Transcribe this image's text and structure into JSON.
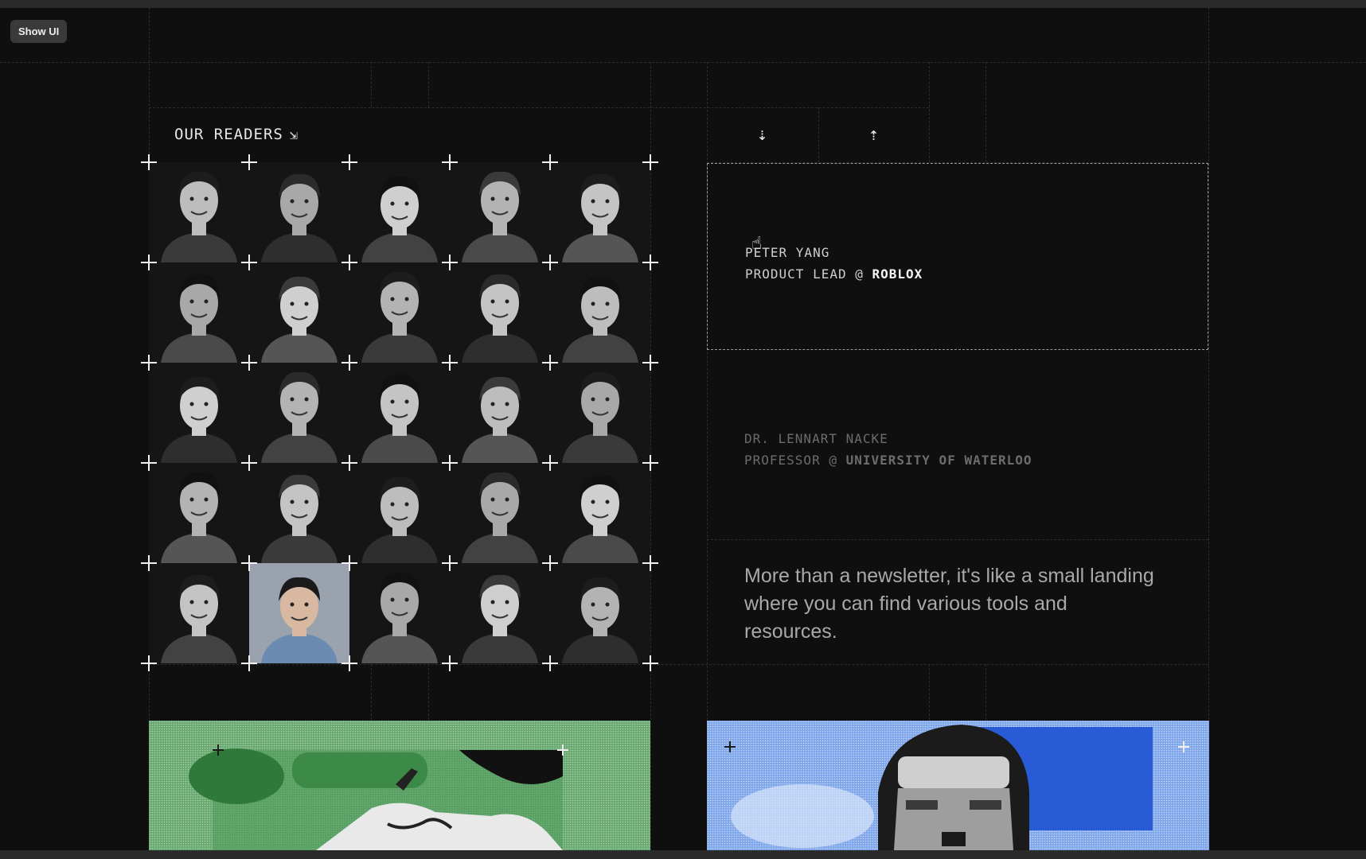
{
  "toolbar": {
    "show_ui_label": "Show UI"
  },
  "readers": {
    "title": "OUR READERS",
    "title_arrow_icon": "arrow-down-right-icon",
    "grid": {
      "rows": 5,
      "cols": 5,
      "highlighted_cell": 21
    }
  },
  "nav": {
    "down_icon": "arrow-down-icon",
    "down_glyph": "⇣",
    "up_icon": "arrow-up-icon",
    "up_glyph": "⇡"
  },
  "testimonials": [
    {
      "name": "PETER YANG",
      "role_prefix": "PRODUCT LEAD @ ",
      "company": "ROBLOX",
      "active": true
    },
    {
      "name": "DR. LENNART NACKE",
      "role_prefix": "PROFESSOR @ ",
      "company": "UNIVERSITY OF WATERLOO",
      "active": false
    }
  ],
  "tagline": "More than a newsletter, it's like a small landing where you can find various tools and resources.",
  "colors": {
    "background": "#0f0f0f",
    "green_banner": "#7fbb86",
    "blue_banner": "#7fa6ec",
    "accent_text": "#f5f5f5"
  }
}
